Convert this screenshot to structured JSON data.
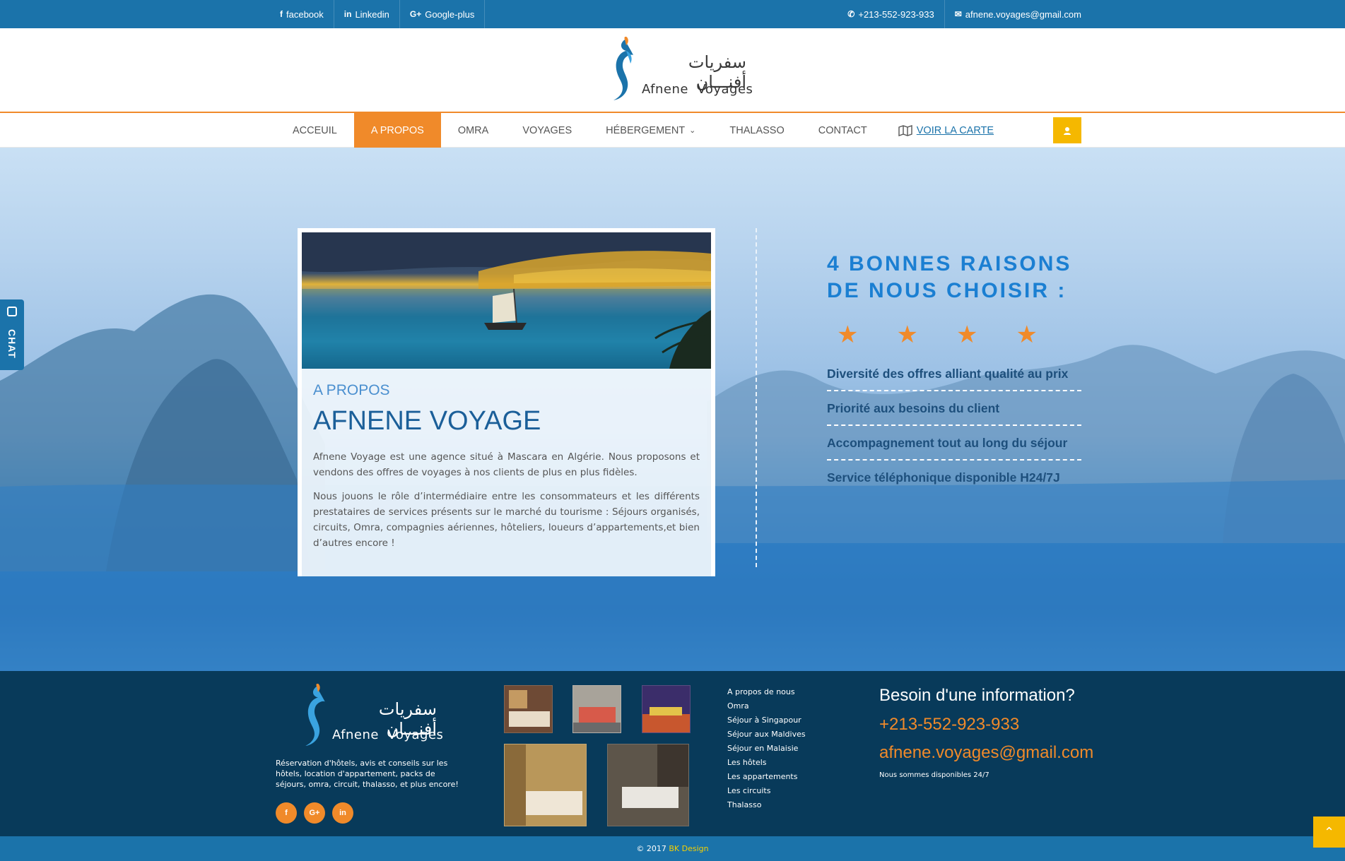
{
  "topbar": {
    "social": [
      {
        "icon": "facebook-icon",
        "glyph": "f",
        "label": "facebook"
      },
      {
        "icon": "linkedin-icon",
        "glyph": "in",
        "label": "Linkedin"
      },
      {
        "icon": "google-plus-icon",
        "glyph": "G+",
        "label": "Google-plus"
      }
    ],
    "phone": "+213-552-923-933",
    "email": "afnene.voyages@gmail.com"
  },
  "logo": {
    "arabic": "سفريات أفنـــان",
    "latin": "Afnene  Voyages"
  },
  "nav": {
    "items": [
      "ACCEUIL",
      "A PROPOS",
      "OMRA",
      "VOYAGES",
      "HÉBERGEMENT",
      "THALASSO",
      "CONTACT"
    ],
    "active_index": 1,
    "map_label": "VOIR LA CARTE"
  },
  "chat": {
    "label": "CHAT"
  },
  "about": {
    "kicker": "A PROPOS",
    "title": "AFNENE VOYAGE",
    "p1": "Afnene Voyage est une agence situé à Mascara en Algérie. Nous proposons et vendons des offres de voyages à nos clients de plus en plus fidèles.",
    "p2": "Nous jouons le rôle d’intermédiaire entre les consommateurs et les différents prestataires de services présents sur le marché du tourisme : Séjours organisés, circuits, Omra, compagnies aériennes, hôteliers, loueurs d’appartements,et bien d’autres encore !"
  },
  "reasons": {
    "heading_line1": "4 BONNES RAISONS",
    "heading_line2": "DE NOUS CHOISIR :",
    "stars": 4,
    "items": [
      "Diversité des offres alliant qualité au prix",
      "Priorité aux besoins du client",
      "Accompagnement tout au long du séjour",
      "Service téléphonique disponible H24/7J"
    ]
  },
  "footer": {
    "description": "Réservation d'hôtels, avis et conseils sur les hôtels, location d'appartement, packs de séjours, omra, circuit, thalasso, et plus encore!",
    "social": [
      {
        "icon": "facebook-icon",
        "glyph": "f"
      },
      {
        "icon": "google-plus-icon",
        "glyph": "G+"
      },
      {
        "icon": "linkedin-icon",
        "glyph": "in"
      }
    ],
    "links": [
      "A propos de nous",
      "Omra",
      "Séjour à Singapour",
      "Séjour aux Maldives",
      "Séjour en Malaisie",
      "Les hôtels",
      "Les appartements",
      "Les circuits",
      "Thalasso"
    ],
    "info_title": "Besoin d'une information?",
    "phone": "+213-552-923-933",
    "email": "afnene.voyages@gmail.com",
    "availability": "Nous sommes disponibles 24/7"
  },
  "copyright": {
    "prefix": "© 2017",
    "brand": "BK Design"
  },
  "colors": {
    "topbar": "#1b73aa",
    "accent": "#f08a2a",
    "footer": "#083a5a",
    "highlight": "#f5b800"
  }
}
